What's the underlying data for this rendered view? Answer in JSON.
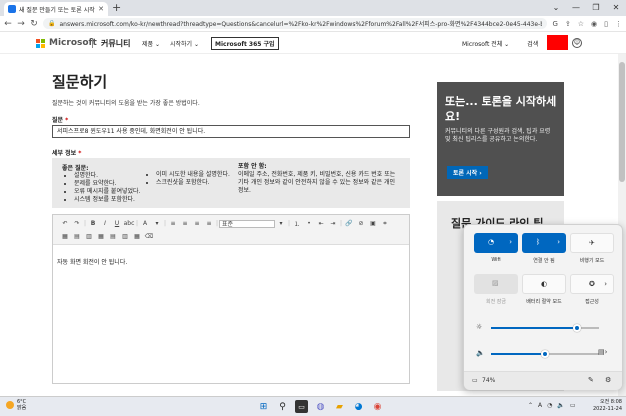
{
  "browser": {
    "tab_title": "새 질문 만들기 또는 토론 시작",
    "url": "answers.microsoft.com/ko-kr/newthread?threadtype=Questions&cancelurl=%2Fko-kr%2Fwindows%2Fforum%2Fall%2F서피스-pro-화면%2F4344bce2-0e45-443e-bb15-c7..."
  },
  "header": {
    "brand": "Microsoft",
    "community": "커뮤니티",
    "nav": [
      "제품 ⌄",
      "시작하기 ⌄"
    ],
    "buy_button": "Microsoft 365 구입",
    "all_ms": "Microsoft 전체 ⌄",
    "search": "검색",
    "accent_color": "#ff0000"
  },
  "page": {
    "title": "질문하기",
    "lead": "질문하는 것이 커뮤니티의 도움을 받는 가장 좋은 방법이다.",
    "subject_label": "질문",
    "required_mark": "*",
    "subject_value": "서피스프로8 윈도우11 사용 중인데, 화면회전이 안 됩니다.",
    "details_label": "세부 정보",
    "tips_title": "좋은 질문:",
    "tips_col1": [
      "설명한다.",
      "문제를 요약한다.",
      "오류 메시지를 붙여넣었다.",
      "시스템 정보를 포함한다."
    ],
    "tips_col2": [
      "이미 시도한 내용을 설명한다.",
      "스크린샷을 포함한다."
    ],
    "privacy_title": "포함 안 함:",
    "privacy_text": "이메일 주소, 전화번호, 제품 키, 비밀번호, 신용 카드 번호 또는 기타 개인 정보와 같이 안전하지 않을 수 있는 정보와 같은 개인 정보.",
    "editor_format": "표준",
    "editor_body": "자동 화면 회전이 안 됩니다."
  },
  "aside": {
    "promo_title": "또는... 토론을 시작하세요!",
    "promo_desc": "커뮤니티의 다른 구성원과 검색, 팁과 요령 및 최신 팁리스를 공유하고 논의한다.",
    "promo_button": "토론 시작 ›",
    "section2_title": "질문 가이드 라인 팁"
  },
  "quick_settings": {
    "tiles": [
      {
        "label": "Wifi",
        "state": "on"
      },
      {
        "label": "연결 안 됨",
        "state": "on"
      },
      {
        "label": "비행기 모드",
        "state": "off"
      },
      {
        "label": "회전 잠금",
        "state": "dim"
      },
      {
        "label": "배터리 절약 모드",
        "state": "off"
      },
      {
        "label": "접근성",
        "state": "off"
      }
    ],
    "brightness_level": 0.8,
    "volume_level": 0.5,
    "battery": "74%"
  },
  "taskbar": {
    "temp": "6°C",
    "weather": "맑음",
    "time": "오전 8:08",
    "date": "2022-11-24",
    "tray_lang": "A"
  }
}
